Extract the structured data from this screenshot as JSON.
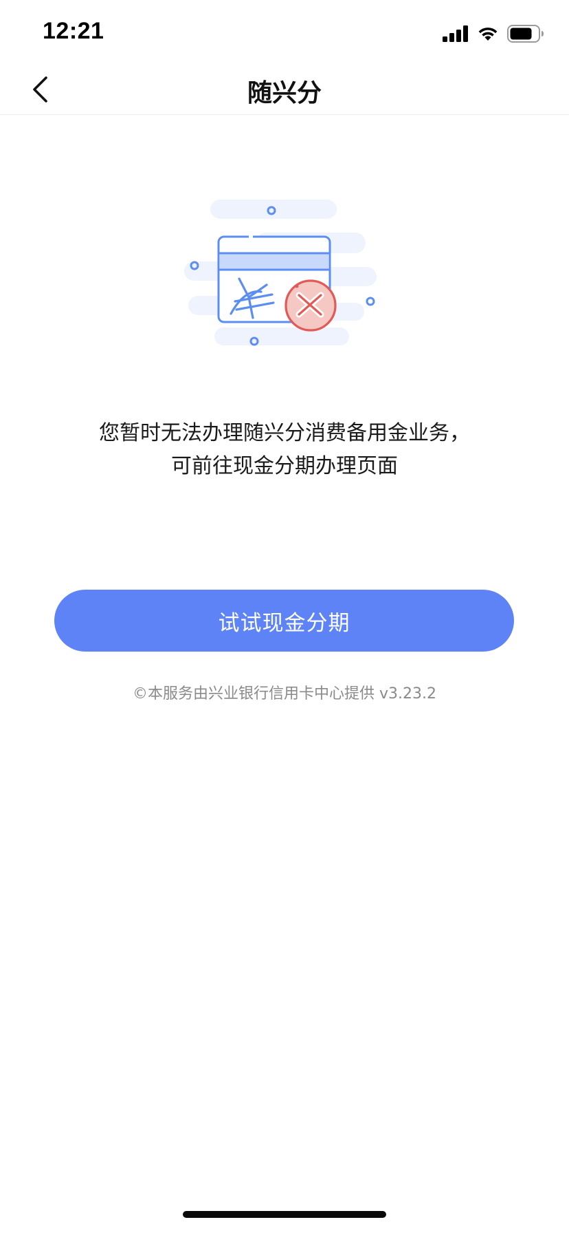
{
  "status_bar": {
    "time": "12:21",
    "icons": [
      "signal-icon",
      "wifi-icon",
      "battery-icon"
    ]
  },
  "nav": {
    "back_icon": "chevron-left-icon",
    "title": "随兴分"
  },
  "illustration": {
    "name": "card-failure-illustration",
    "icons": [
      "credit-card-icon",
      "yuan-icon",
      "error-x-icon"
    ],
    "colors": {
      "blue": "#5b8ef0",
      "light_blue": "#c9d9fb",
      "cloud": "#eef3fd",
      "red": "#e25a55",
      "light_red": "#f6c8c4"
    }
  },
  "message": {
    "line1": "您暂时无法办理随兴分消费备用金业务，",
    "line2": "可前往现金分期办理页面"
  },
  "primary_button": {
    "label": "试试现金分期",
    "color": "#5d83f6"
  },
  "footer": {
    "note": "©本服务由兴业银行信用卡中心提供 v3.23.2"
  }
}
